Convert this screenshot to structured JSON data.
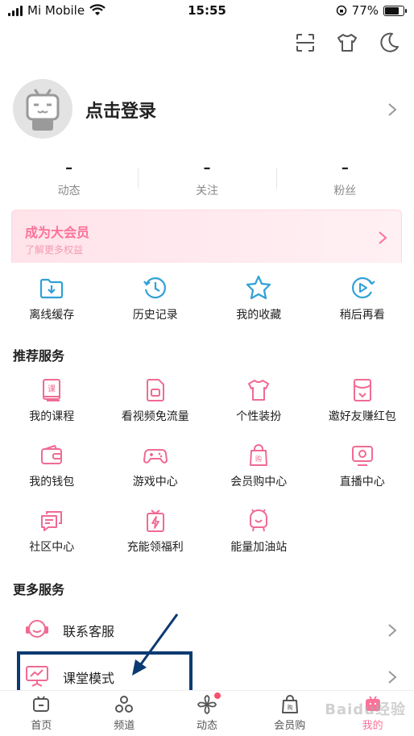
{
  "status_bar": {
    "carrier": "Mi Mobile",
    "time": "15:55",
    "battery": "77%",
    "battery_level": 0.77
  },
  "profile": {
    "login_label": "点击登录"
  },
  "stats": [
    {
      "value": "–",
      "label": "动态"
    },
    {
      "value": "–",
      "label": "关注"
    },
    {
      "value": "–",
      "label": "粉丝"
    }
  ],
  "vip": {
    "title": "成为大会员",
    "subtitle": "了解更多权益"
  },
  "quick_actions": [
    {
      "label": "离线缓存",
      "icon": "download-folder-icon"
    },
    {
      "label": "历史记录",
      "icon": "history-clock-icon"
    },
    {
      "label": "我的收藏",
      "icon": "star-icon"
    },
    {
      "label": "稍后再看",
      "icon": "watch-later-icon"
    }
  ],
  "recommended": {
    "title": "推荐服务",
    "items": [
      {
        "label": "我的课程",
        "icon": "course-book-icon"
      },
      {
        "label": "看视频免流量",
        "icon": "sim-card-icon"
      },
      {
        "label": "个性装扮",
        "icon": "tshirt-icon"
      },
      {
        "label": "邀好友赚红包",
        "icon": "red-envelope-icon"
      },
      {
        "label": "我的钱包",
        "icon": "wallet-icon"
      },
      {
        "label": "游戏中心",
        "icon": "gamepad-icon"
      },
      {
        "label": "会员购中心",
        "icon": "shopping-bag-icon"
      },
      {
        "label": "直播中心",
        "icon": "live-tv-icon"
      },
      {
        "label": "社区中心",
        "icon": "chat-bubbles-icon"
      },
      {
        "label": "充能领福利",
        "icon": "gift-bolt-icon"
      },
      {
        "label": "能量加油站",
        "icon": "energy-station-icon"
      }
    ]
  },
  "more": {
    "title": "更多服务",
    "items": [
      {
        "label": "联系客服",
        "icon": "headset-icon"
      },
      {
        "label": "课堂模式",
        "icon": "classroom-icon"
      }
    ]
  },
  "tabs": [
    {
      "label": "首页",
      "icon": "home-tv-icon"
    },
    {
      "label": "频道",
      "icon": "channel-icon"
    },
    {
      "label": "动态",
      "icon": "pinwheel-icon"
    },
    {
      "label": "会员购",
      "icon": "shopping-bag-icon"
    },
    {
      "label": "我的",
      "icon": "my-tv-icon"
    }
  ],
  "watermark": "Baidu经验",
  "colors": {
    "accent": "#fb7299",
    "annotation": "#0b3a72",
    "icon_blue": "#2fa1d6"
  }
}
